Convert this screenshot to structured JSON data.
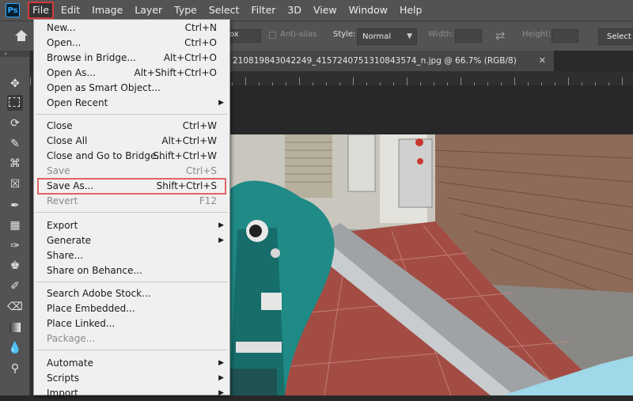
{
  "app": {
    "logo": "Ps"
  },
  "menubar": {
    "items": [
      "File",
      "Edit",
      "Image",
      "Layer",
      "Type",
      "Select",
      "Filter",
      "3D",
      "View",
      "Window",
      "Help"
    ]
  },
  "options": {
    "feather_partial": "ox",
    "anti_alias": "Anti-alias",
    "style_label": "Style:",
    "style_value": "Normal",
    "width_label": "Width:",
    "height_label": "Height:",
    "select_mask_partial": "Select a"
  },
  "document": {
    "tab_title": "210819843042249_4157240751310843574_n.jpg @ 66.7% (RGB/8)",
    "close_glyph": "✕"
  },
  "file_menu": {
    "items": [
      {
        "label": "New...",
        "shortcut": "Ctrl+N"
      },
      {
        "label": "Open...",
        "shortcut": "Ctrl+O"
      },
      {
        "label": "Browse in Bridge...",
        "shortcut": "Alt+Ctrl+O"
      },
      {
        "label": "Open As...",
        "shortcut": "Alt+Shift+Ctrl+O"
      },
      {
        "label": "Open as Smart Object...",
        "shortcut": ""
      },
      {
        "label": "Open Recent",
        "shortcut": ""
      },
      {
        "label": "Close",
        "shortcut": "Ctrl+W"
      },
      {
        "label": "Close All",
        "shortcut": "Alt+Ctrl+W"
      },
      {
        "label": "Close and Go to Bridge...",
        "shortcut": "Shift+Ctrl+W"
      },
      {
        "label": "Save",
        "shortcut": "Ctrl+S"
      },
      {
        "label": "Save As...",
        "shortcut": "Shift+Ctrl+S"
      },
      {
        "label": "Revert",
        "shortcut": "F12"
      },
      {
        "label": "Export",
        "shortcut": ""
      },
      {
        "label": "Generate",
        "shortcut": ""
      },
      {
        "label": "Share...",
        "shortcut": ""
      },
      {
        "label": "Share on Behance...",
        "shortcut": ""
      },
      {
        "label": "Search Adobe Stock...",
        "shortcut": ""
      },
      {
        "label": "Place Embedded...",
        "shortcut": ""
      },
      {
        "label": "Place Linked...",
        "shortcut": ""
      },
      {
        "label": "Package...",
        "shortcut": ""
      },
      {
        "label": "Automate",
        "shortcut": ""
      },
      {
        "label": "Scripts",
        "shortcut": ""
      },
      {
        "label": "Import",
        "shortcut": ""
      }
    ]
  },
  "toolbar": {
    "header": "»",
    "tools": [
      "move-icon",
      "marquee-icon",
      "lasso-icon",
      "quick-select-icon",
      "crop-icon",
      "frame-icon",
      "eyedropper-icon",
      "healing-brush-icon",
      "brush-icon",
      "clone-stamp-icon",
      "history-brush-icon",
      "eraser-icon",
      "gradient-icon",
      "blur-icon",
      "dodge-icon"
    ]
  },
  "colors": {
    "chrome": "#535353",
    "menu_bg": "#f0f0f0",
    "highlight_border": "#e26464",
    "active_menu_border": "#d23b3b"
  }
}
